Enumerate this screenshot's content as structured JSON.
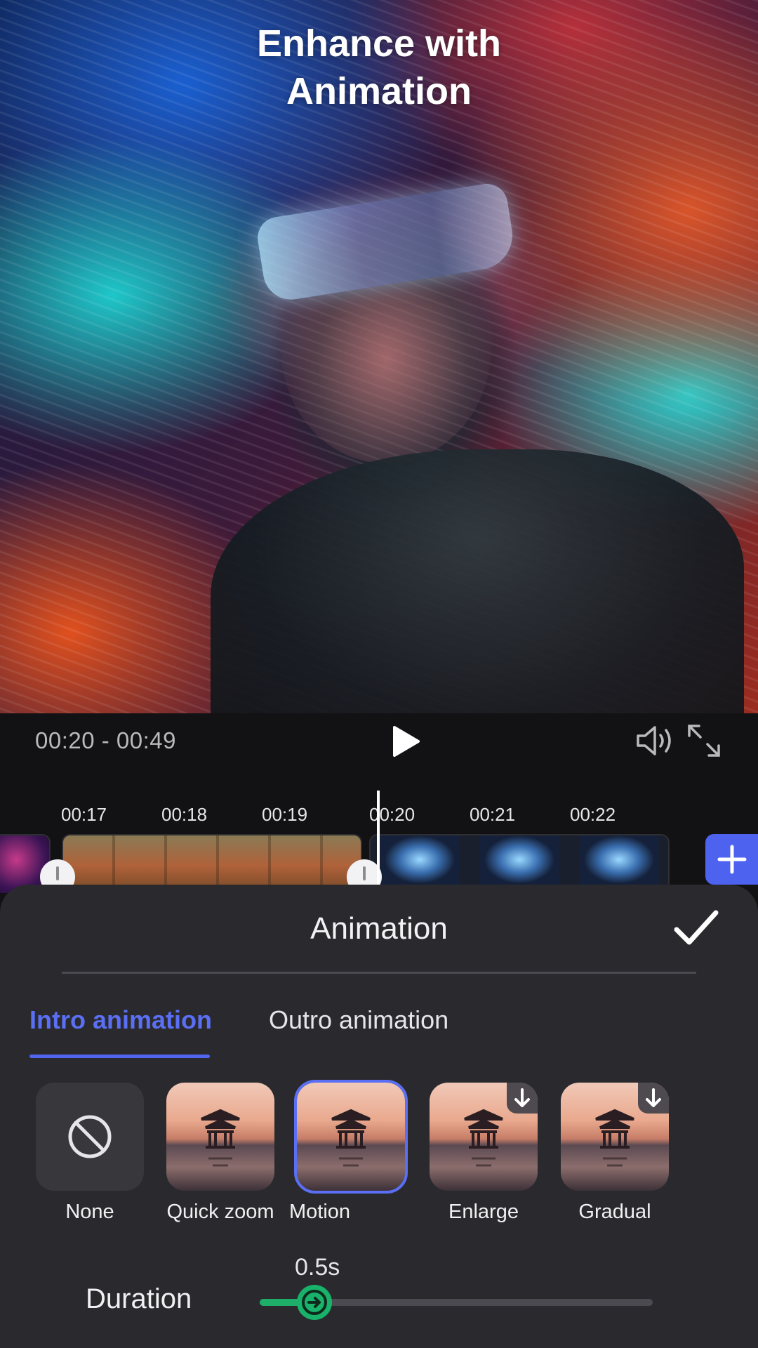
{
  "preview": {
    "headline_line1": "Enhance with",
    "headline_line2": "Animation"
  },
  "playback": {
    "timecode": "00:20 - 00:49",
    "play_icon": "play-icon",
    "volume_icon": "volume-icon",
    "fullscreen_icon": "fullscreen-icon"
  },
  "timeline": {
    "ticks": [
      "00:17",
      "00:18",
      "00:19",
      "00:20",
      "00:21",
      "00:22"
    ],
    "add_icon": "plus-icon"
  },
  "sheet": {
    "title": "Animation",
    "confirm_icon": "checkmark-icon",
    "tabs": [
      {
        "label": "Intro animation",
        "active": true
      },
      {
        "label": "Outro animation",
        "active": false
      }
    ],
    "options": [
      {
        "label": "None",
        "icon": "no-entry-icon"
      },
      {
        "label": "Quick zoom"
      },
      {
        "label": "Motion",
        "selected": true
      },
      {
        "label": "Enlarge",
        "download_icon": "download-icon"
      },
      {
        "label": "Gradual",
        "download_icon": "download-icon"
      }
    ],
    "duration": {
      "label": "Duration",
      "value": "0.5s",
      "level": 0.14
    }
  },
  "colors": {
    "accent": "#5a6ff3",
    "slider": "#1fae6a",
    "sheet_bg": "#2a2a2e"
  }
}
